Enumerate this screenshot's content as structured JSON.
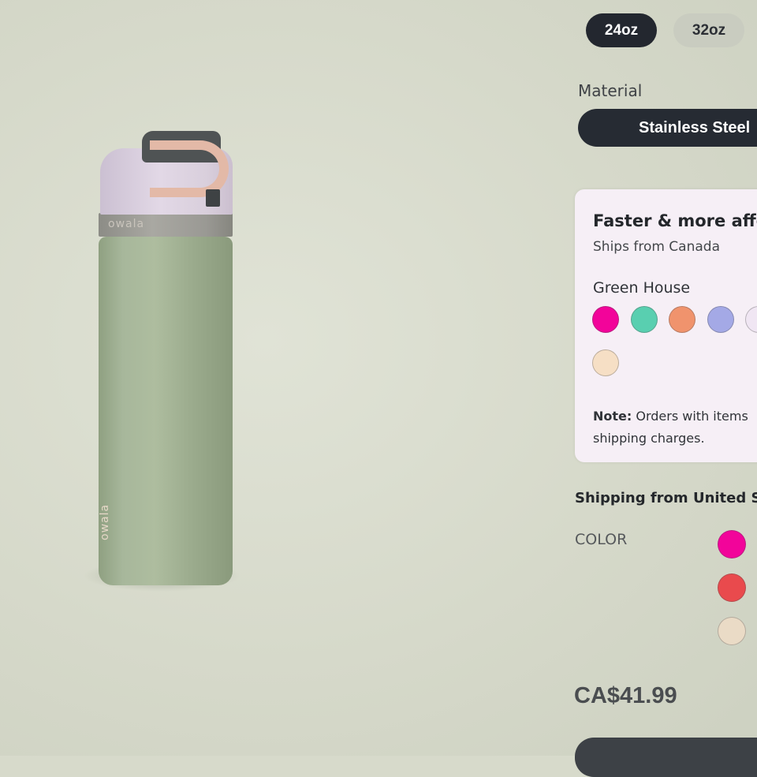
{
  "product_image": {
    "band_logo": "owala",
    "body_logo": "owala"
  },
  "sizes": [
    {
      "label": "24oz",
      "selected": true
    },
    {
      "label": "32oz",
      "selected": false
    }
  ],
  "material": {
    "label": "Material",
    "selected": "Stainless Steel"
  },
  "promo_card": {
    "title": "Faster & more affo",
    "subtitle": "Ships from Canada",
    "color_name": "Green House",
    "swatches": [
      "#f2049a",
      "#59cfb0",
      "#f0936d",
      "#a4a9e6",
      "#f0e6f3",
      "#f6dfc5"
    ],
    "note_bold": "Note:",
    "note_line1": " Orders with items",
    "note_line2": "shipping charges."
  },
  "shipping": {
    "title": "Shipping from United St",
    "color_label": "COLOR",
    "swatches": [
      "#f2049a",
      "#e94a4d",
      "#eadbc6"
    ]
  },
  "price": "CA$41.99",
  "colors": {
    "dark": "#23272f",
    "page_bg": "#d7dacb"
  }
}
